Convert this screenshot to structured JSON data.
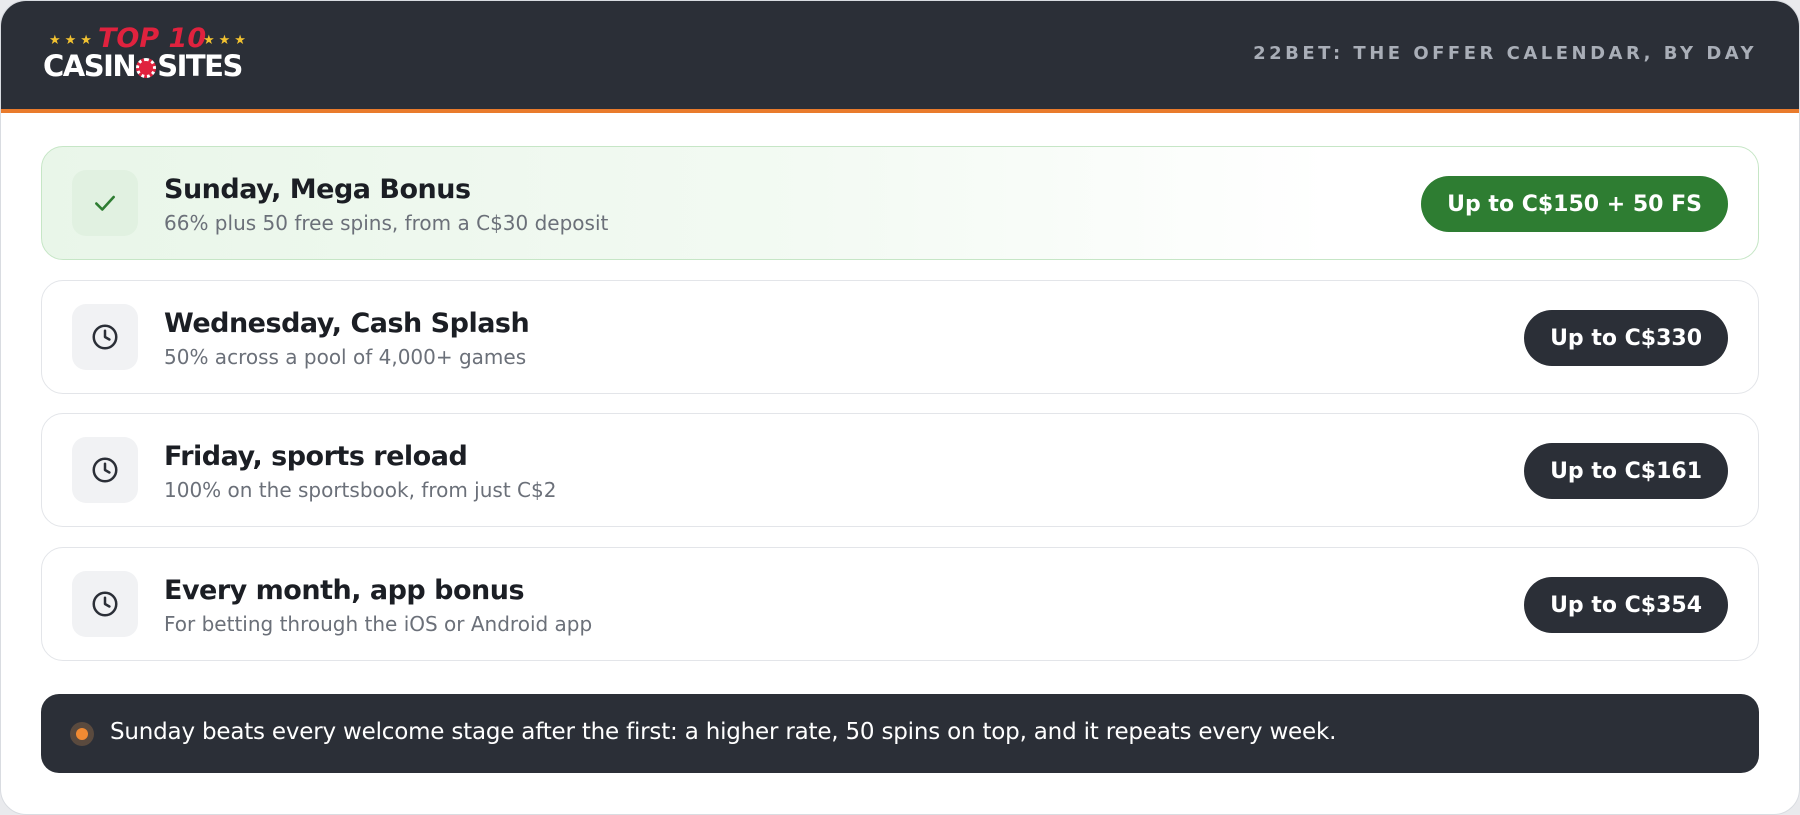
{
  "brand": {
    "logo_top": "TOP 10",
    "logo_word_left": "CASIN",
    "logo_word_right": "SITES",
    "stars_left": "★★★",
    "stars_right": "★★★",
    "logo_colors": {
      "accent": "#e0223e",
      "stars": "#f2c230"
    }
  },
  "header": {
    "title": "22BET: THE OFFER CALENDAR, BY DAY",
    "background": "#2b2f37",
    "accent_line": "#e97b2c"
  },
  "offers": [
    {
      "title": "Sunday, Mega Bonus",
      "subtitle": "66% plus 50 free spins, from a C$30 deposit",
      "amount": "Up to C$150 + 50 FS",
      "icon": "check-icon",
      "highlighted": true,
      "accent": "#2e7d32"
    },
    {
      "title": "Wednesday, Cash Splash",
      "subtitle": "50% across a pool of 4,000+ games",
      "amount": "Up to C$330",
      "icon": "clock-icon",
      "highlighted": false
    },
    {
      "title": "Friday, sports reload",
      "subtitle": "100% on the sportsbook, from just C$2",
      "amount": "Up to C$161",
      "icon": "clock-icon",
      "highlighted": false
    },
    {
      "title": "Every month, app bonus",
      "subtitle": "For betting through the iOS or Android app",
      "amount": "Up to C$354",
      "icon": "clock-icon",
      "highlighted": false
    }
  ],
  "note": {
    "text": "Sunday beats every welcome stage after the first: a higher rate, 50 spins on top, and it repeats every week.",
    "dot_color": "#f08a33"
  }
}
